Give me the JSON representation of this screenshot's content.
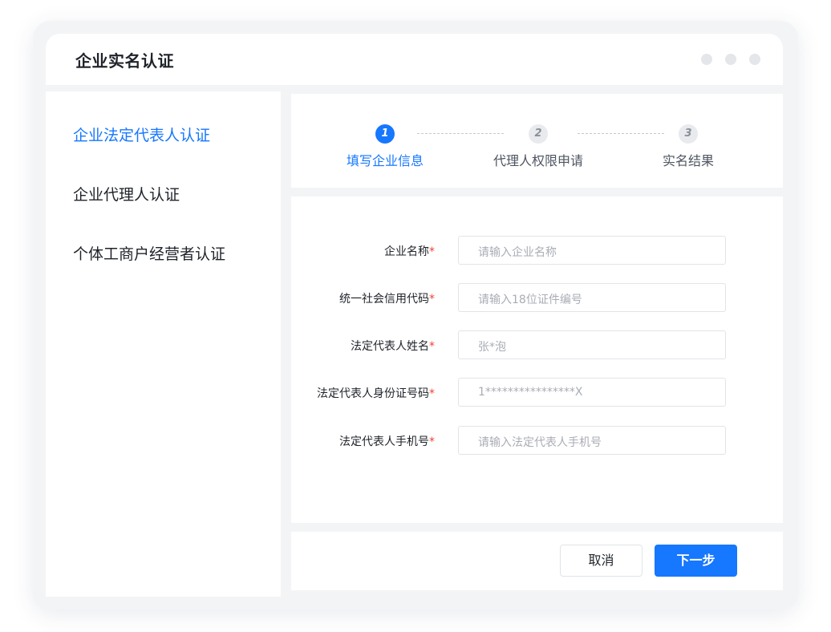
{
  "window": {
    "title": "企业实名认证"
  },
  "sidebar": {
    "items": [
      {
        "label": "企业法定代表人认证",
        "active": true
      },
      {
        "label": "企业代理人认证",
        "active": false
      },
      {
        "label": "个体工商户经营者认证",
        "active": false
      }
    ]
  },
  "steps": [
    {
      "number": "1",
      "label": "填写企业信息",
      "active": true
    },
    {
      "number": "2",
      "label": "代理人权限申请",
      "active": false
    },
    {
      "number": "3",
      "label": "实名结果",
      "active": false
    }
  ],
  "form": {
    "required_mark": "*",
    "fields": [
      {
        "label": "企业名称",
        "placeholder": "请输入企业名称"
      },
      {
        "label": "统一社会信用代码",
        "placeholder": "请输入18位证件编号"
      },
      {
        "label": "法定代表人姓名",
        "placeholder": "张*泡"
      },
      {
        "label": "法定代表人身份证号码",
        "placeholder": "1****************X"
      },
      {
        "label": "法定代表人手机号",
        "placeholder": "请输入法定代表人手机号"
      }
    ]
  },
  "footer": {
    "cancel_label": "取消",
    "next_label": "下一步"
  },
  "colors": {
    "accent": "#1677ff",
    "required": "#f04134",
    "background": "#f3f4f6"
  }
}
